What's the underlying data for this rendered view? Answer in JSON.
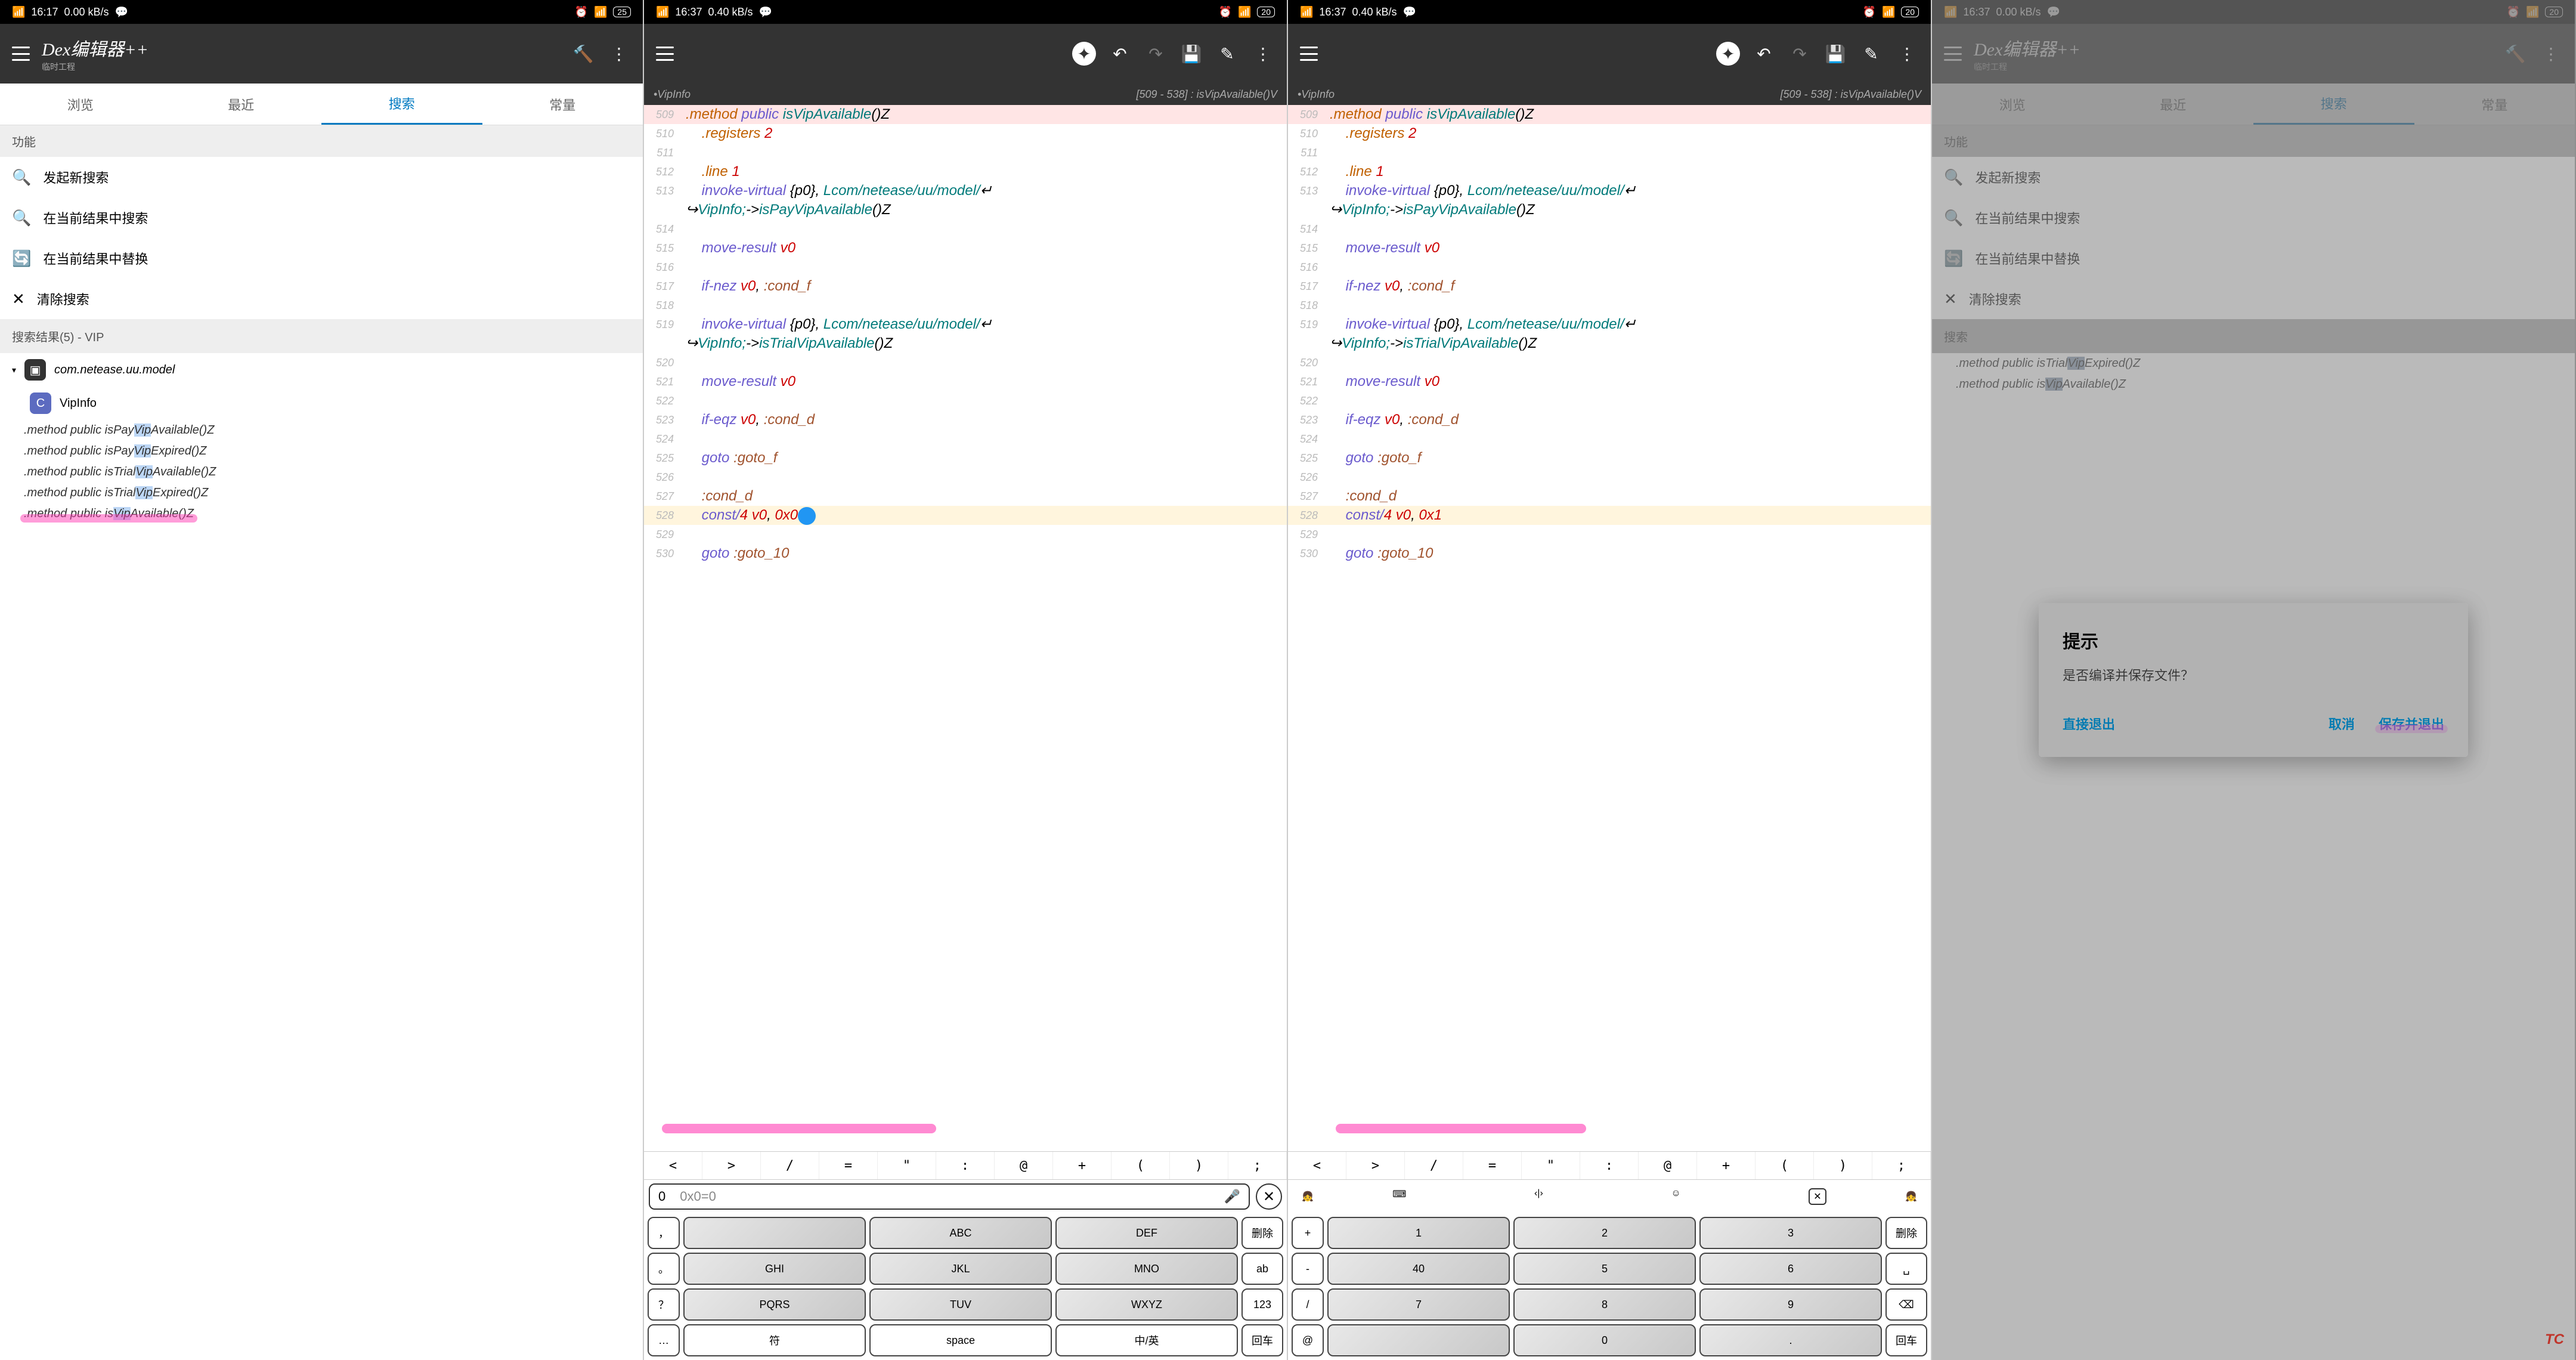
{
  "status_bars": [
    {
      "time": "16:17",
      "net": "4G",
      "speed": "0.00 kB/s",
      "batt": "25"
    },
    {
      "time": "16:37",
      "net": "4G",
      "speed": "0.40 kB/s",
      "batt": "20"
    },
    {
      "time": "16:37",
      "net": "4G",
      "speed": "0.40 kB/s",
      "batt": "20"
    },
    {
      "time": "16:37",
      "net": "4G",
      "speed": "0.00 kB/s",
      "batt": "20"
    }
  ],
  "app": {
    "title": "Dex编辑器++",
    "subtitle": "临时工程"
  },
  "tabs": [
    "浏览",
    "最近",
    "搜索",
    "常量"
  ],
  "active_tab": 2,
  "section_func": "功能",
  "actions": [
    {
      "icon": "search",
      "label": "发起新搜索"
    },
    {
      "icon": "search",
      "label": "在当前结果中搜索"
    },
    {
      "icon": "replace",
      "label": "在当前结果中替换"
    },
    {
      "icon": "close",
      "label": "清除搜索"
    }
  ],
  "results_header": "搜索结果(5) - VIP",
  "package": "com.netease.uu.model",
  "class_name": "VipInfo",
  "methods": [
    ".method public isPayVipAvailable()Z",
    ".method public isPayVipExpired()Z",
    ".method public isTrialVipAvailable()Z",
    ".method public isTrialVipExpired()Z",
    ".method public isVipAvailable()Z"
  ],
  "breadcrumb_left": "•VipInfo",
  "breadcrumb_right": "[509 - 538] : isVipAvailable()V",
  "code_lines": [
    {
      "n": 509,
      "t": ".method public isVipAvailable()Z",
      "cls": "hl-method"
    },
    {
      "n": 510,
      "t": "    .registers 2"
    },
    {
      "n": 511,
      "t": ""
    },
    {
      "n": 512,
      "t": "    .line 1"
    },
    {
      "n": 513,
      "t": "    invoke-virtual {p0}, Lcom/netease/uu/model/↵"
    },
    {
      "n": 0,
      "t": "↪VipInfo;->isPayVipAvailable()Z"
    },
    {
      "n": 514,
      "t": ""
    },
    {
      "n": 515,
      "t": "    move-result v0"
    },
    {
      "n": 516,
      "t": ""
    },
    {
      "n": 517,
      "t": "    if-nez v0, :cond_f"
    },
    {
      "n": 518,
      "t": ""
    },
    {
      "n": 519,
      "t": "    invoke-virtual {p0}, Lcom/netease/uu/model/↵"
    },
    {
      "n": 0,
      "t": "↪VipInfo;->isTrialVipAvailable()Z"
    },
    {
      "n": 520,
      "t": ""
    },
    {
      "n": 521,
      "t": "    move-result v0"
    },
    {
      "n": 522,
      "t": ""
    },
    {
      "n": 523,
      "t": "    if-eqz v0, :cond_d"
    },
    {
      "n": 524,
      "t": ""
    },
    {
      "n": 525,
      "t": "    goto :goto_f"
    },
    {
      "n": 526,
      "t": ""
    },
    {
      "n": 527,
      "t": "    :cond_d"
    },
    {
      "n": 528,
      "t": "    const/4 v0, 0x0",
      "cls": "hl-line",
      "edit": "0x0"
    },
    {
      "n": 529,
      "t": ""
    },
    {
      "n": 530,
      "t": "    goto :goto_10"
    }
  ],
  "edit_after": "0x1",
  "sym_row": [
    "<",
    ">",
    "/",
    "=",
    "\"",
    ":",
    "@",
    "+",
    "(",
    ")",
    ";"
  ],
  "kb_input": {
    "typed": "0",
    "candidate": "0x0=0"
  },
  "kb_labels": {
    "del": "删除",
    "ab": "ab",
    "num": "123",
    "ret": "回车",
    "sym": "符",
    "space": "space",
    "lang": "中/英"
  },
  "kb_letter_rows": [
    [
      "ABC",
      "DEF"
    ],
    [
      "GHI",
      "JKL",
      "MNO"
    ],
    [
      "PQRS",
      "TUV",
      "WXYZ"
    ]
  ],
  "kb_num_rows": [
    [
      "1",
      "2",
      "3"
    ],
    [
      "40",
      "5",
      "6"
    ],
    [
      "7",
      "8",
      "9"
    ],
    [
      "",
      "0",
      "."
    ]
  ],
  "kb_left_col": [
    "，",
    "。",
    "？",
    "…"
  ],
  "kb_left_col2": [
    "+",
    "-",
    "/",
    "@"
  ],
  "dialog": {
    "title": "提示",
    "message": "是否编译并保存文件？",
    "actions": [
      "直接退出",
      "取消",
      "保存并退出"
    ]
  },
  "watermark": "TC"
}
